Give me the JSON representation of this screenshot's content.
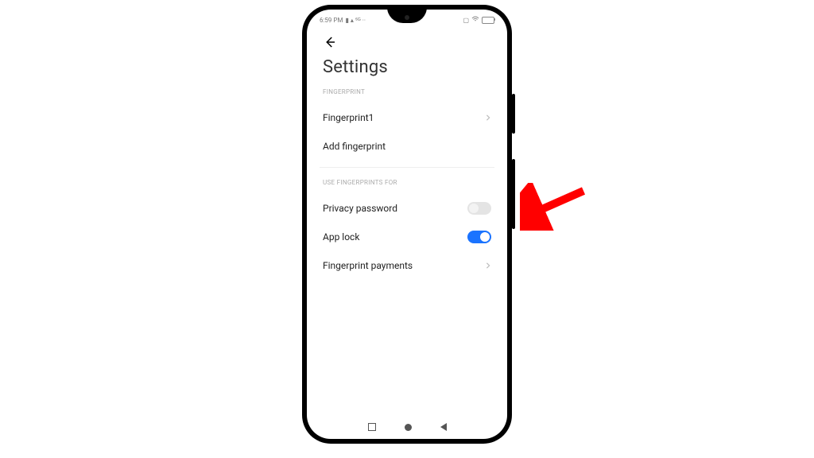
{
  "statusbar": {
    "time": "6:59 PM",
    "indicators": "▮ ▴ ⁵ᴳ ··"
  },
  "page": {
    "title": "Settings"
  },
  "sections": {
    "fingerprint": {
      "label": "FINGERPRINT",
      "items": {
        "fp1": "Fingerprint1",
        "add": "Add fingerprint"
      }
    },
    "use_for": {
      "label": "USE FINGERPRINTS FOR",
      "privacy": "Privacy password",
      "applock": "App lock",
      "payments": "Fingerprint payments"
    }
  },
  "toggles": {
    "privacy": false,
    "applock": true
  }
}
